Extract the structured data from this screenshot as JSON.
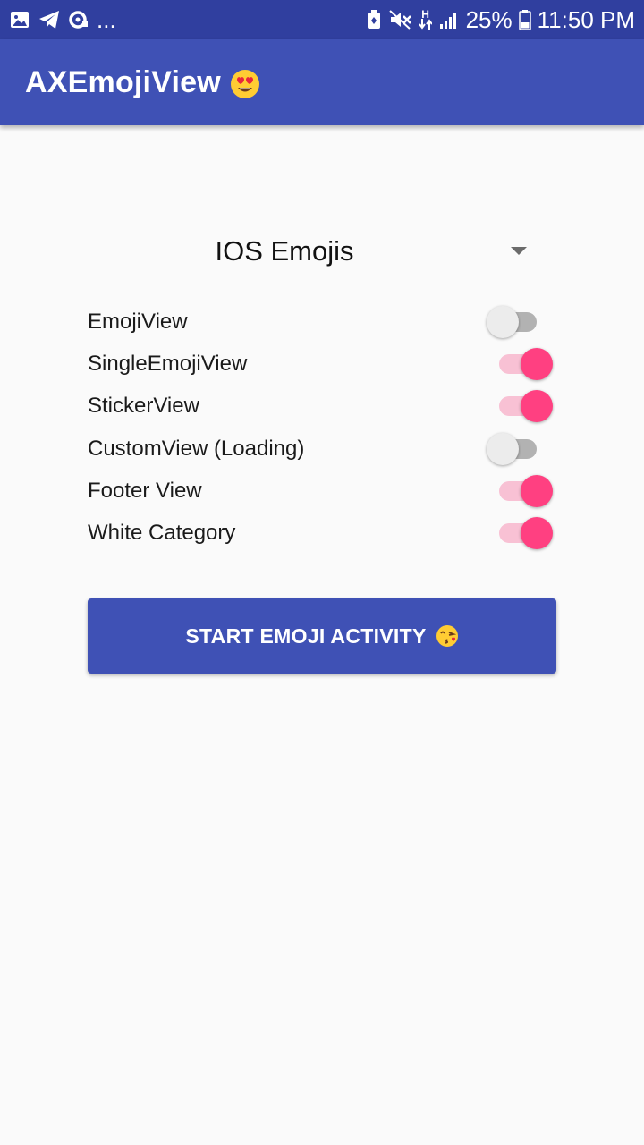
{
  "status_bar": {
    "notifications_more": "...",
    "battery_percent": "25%",
    "time": "11:50 PM",
    "network_type": "H",
    "icons": [
      "gallery-icon",
      "telegram-icon",
      "sync-icon",
      "battery-saver-icon",
      "mute-icon",
      "data-arrows-icon",
      "signal-icon",
      "battery-icon"
    ]
  },
  "app_bar": {
    "title": "AXEmojiView",
    "title_emoji": "heart-eyes-emoji",
    "color": "#3f51b5",
    "status_color": "#303f9f"
  },
  "spinner": {
    "selected": "IOS Emojis"
  },
  "switches": [
    {
      "label": "EmojiView",
      "checked": false
    },
    {
      "label": "SingleEmojiView",
      "checked": true
    },
    {
      "label": "StickerView",
      "checked": true
    },
    {
      "label": "CustomView (Loading)",
      "checked": false
    },
    {
      "label": "Footer View",
      "checked": true
    },
    {
      "label": "White Category",
      "checked": true
    }
  ],
  "accent_color": "#ff4081",
  "button": {
    "label": "START EMOJI ACTIVITY",
    "emoji": "kissing-heart-emoji"
  }
}
